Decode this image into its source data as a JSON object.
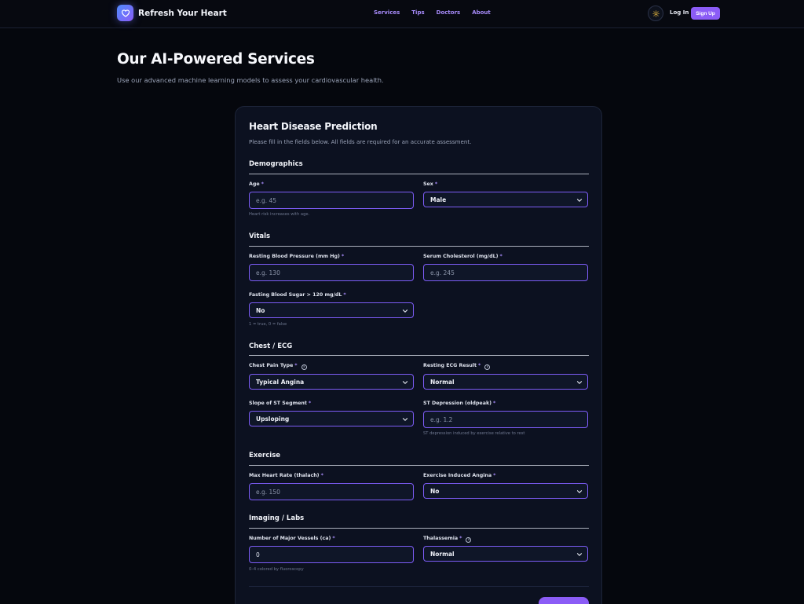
{
  "nav": {
    "brand": "Refresh Your Heart",
    "links": [
      "Services",
      "Tips",
      "Doctors",
      "About"
    ],
    "login": "Log In",
    "signup": "Sign Up"
  },
  "hero": {
    "title": "Our AI-Powered Services",
    "subtitle": "Use our advanced machine learning models to assess your cardiovascular health."
  },
  "form": {
    "title": "Heart Disease Prediction",
    "subtitle": "Please fill in the fields below. All fields are required for an accurate assessment.",
    "required_mark": "*",
    "sections": {
      "demographics": "Demographics",
      "vitals": "Vitals",
      "chest_ecg": "Chest / ECG",
      "exercise": "Exercise",
      "imaging": "Imaging / Labs"
    },
    "fields": {
      "age": {
        "label": "Age",
        "placeholder": "e.g. 45",
        "help": "Heart risk increases with age."
      },
      "sex": {
        "label": "Sex",
        "value": "Male"
      },
      "bp": {
        "label": "Resting Blood Pressure (mm Hg)",
        "placeholder": "e.g. 130"
      },
      "chol": {
        "label": "Serum Cholesterol (mg/dL)",
        "placeholder": "e.g. 245"
      },
      "fbs": {
        "label": "Fasting Blood Sugar > 120 mg/dL",
        "value": "No",
        "help": "1 = true, 0 = false"
      },
      "cp": {
        "label": "Chest Pain Type",
        "value": "Typical Angina"
      },
      "ecg": {
        "label": "Resting ECG Result",
        "value": "Normal"
      },
      "slope": {
        "label": "Slope of ST Segment",
        "value": "Upsloping"
      },
      "oldpeak": {
        "label": "ST Depression (oldpeak)",
        "placeholder": "e.g. 1.2",
        "help": "ST depression induced by exercise relative to rest"
      },
      "thalach": {
        "label": "Max Heart Rate (thalach)",
        "placeholder": "e.g. 150"
      },
      "exang": {
        "label": "Exercise Induced Angina",
        "value": "No"
      },
      "ca": {
        "label": "Number of Major Vessels (ca)",
        "value": "0",
        "help": "0–4 colored by fluoroscopy"
      },
      "thal": {
        "label": "Thalassemia",
        "value": "Normal"
      }
    }
  }
}
